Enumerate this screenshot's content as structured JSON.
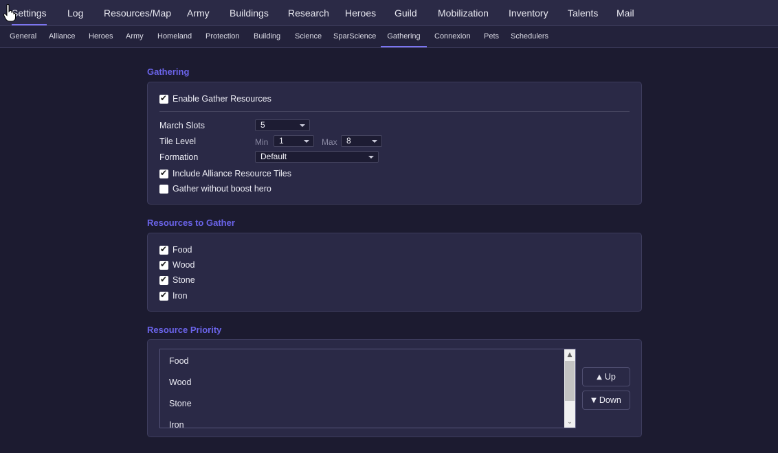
{
  "topnav": {
    "tabs": [
      {
        "label": "Settings"
      },
      {
        "label": "Log"
      },
      {
        "label": "Resources/Map"
      },
      {
        "label": "Army"
      },
      {
        "label": "Buildings"
      },
      {
        "label": "Research"
      },
      {
        "label": "Heroes"
      },
      {
        "label": "Guild"
      },
      {
        "label": "Mobilization"
      },
      {
        "label": "Inventory"
      },
      {
        "label": "Talents"
      },
      {
        "label": "Mail"
      }
    ],
    "active": "Settings"
  },
  "subnav": {
    "tabs": [
      {
        "label": "General"
      },
      {
        "label": "Alliance"
      },
      {
        "label": "Heroes"
      },
      {
        "label": "Army"
      },
      {
        "label": "Homeland"
      },
      {
        "label": "Protection"
      },
      {
        "label": "Building"
      },
      {
        "label": "Science"
      },
      {
        "label": "SparScience"
      },
      {
        "label": "Gathering"
      },
      {
        "label": "Connexion"
      },
      {
        "label": "Pets"
      },
      {
        "label": "Schedulers"
      }
    ],
    "active": "Gathering"
  },
  "gathering": {
    "title": "Gathering",
    "enable_label": "Enable Gather Resources",
    "enable_checked": true,
    "march_slots_label": "March Slots",
    "march_slots_value": "5",
    "tile_level_label": "Tile Level",
    "min_label": "Min",
    "min_value": "1",
    "max_label": "Max",
    "max_value": "8",
    "formation_label": "Formation",
    "formation_value": "Default",
    "include_alliance_label": "Include Alliance Resource Tiles",
    "include_alliance_checked": true,
    "without_boost_label": "Gather without boost hero",
    "without_boost_checked": false
  },
  "resources": {
    "title": "Resources to Gather",
    "items": [
      {
        "label": "Food",
        "checked": true
      },
      {
        "label": "Wood",
        "checked": true
      },
      {
        "label": "Stone",
        "checked": true
      },
      {
        "label": "Iron",
        "checked": true
      }
    ]
  },
  "priority": {
    "title": "Resource Priority",
    "items": [
      "Food",
      "Wood",
      "Stone",
      "Iron"
    ],
    "up_label": "Up",
    "down_label": "Down"
  },
  "colors": {
    "accent": "#6b64ea",
    "background": "#1c1b30",
    "panel": "#2a2946"
  }
}
